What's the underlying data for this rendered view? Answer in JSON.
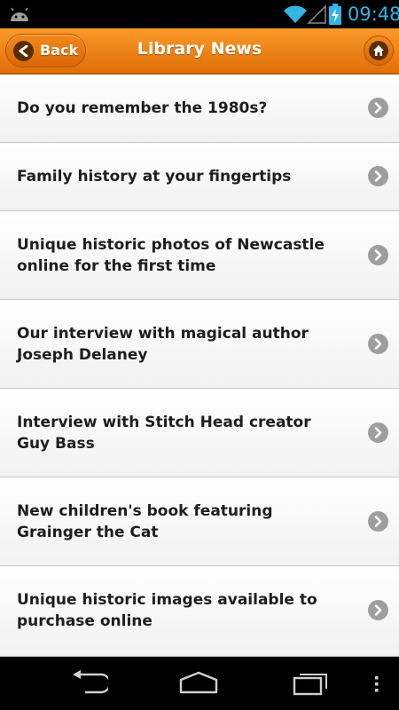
{
  "status_bar": {
    "time": "09:48",
    "icons": [
      "android-icon",
      "wifi-icon",
      "signal-icon",
      "battery-charging-icon"
    ],
    "time_color": "#33b5e5"
  },
  "header": {
    "title": "Library News",
    "back_label": "Back",
    "accent": "#f08a1a"
  },
  "news_items": [
    {
      "title": "Do you remember the 1980s?"
    },
    {
      "title": "Family history at your fingertips"
    },
    {
      "title": "Unique historic photos of Newcastle online for the first time"
    },
    {
      "title": "Our interview with magical author Joseph Delaney"
    },
    {
      "title": "Interview with Stitch Head creator Guy Bass"
    },
    {
      "title": "New children's book featuring Grainger the Cat"
    },
    {
      "title": "Unique historic images available to purchase online"
    }
  ],
  "navbar": {
    "icons": [
      "back-nav-icon",
      "home-nav-icon",
      "recent-apps-icon",
      "overflow-menu-icon"
    ]
  }
}
